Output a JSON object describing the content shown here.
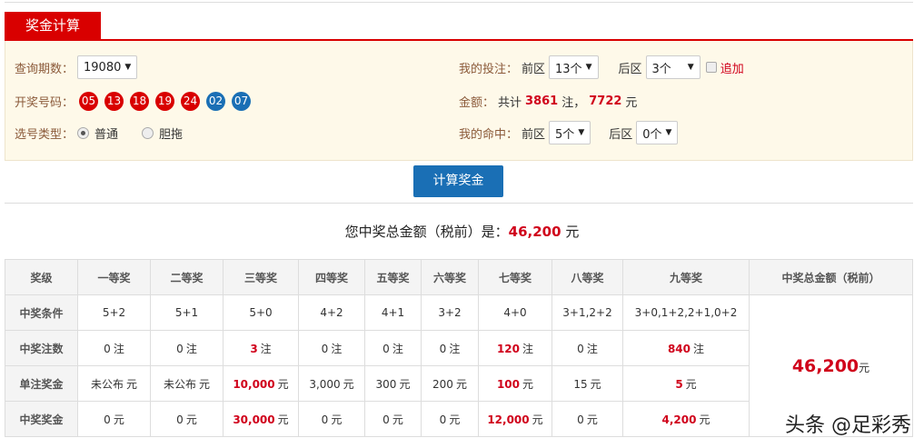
{
  "tab_title": "奖金计算",
  "query": {
    "label": "查询期数：",
    "value": "19080"
  },
  "draw": {
    "label": "开奖号码：",
    "front": [
      "05",
      "13",
      "18",
      "19",
      "24"
    ],
    "back": [
      "02",
      "07"
    ],
    "front_color": "#d90000",
    "back_color": "#1a6fb5"
  },
  "pick_type": {
    "label": "选号类型：",
    "options": [
      "普通",
      "胆拖"
    ],
    "selected": "普通"
  },
  "bet": {
    "label": "我的投注：",
    "front_label": "前区",
    "front_value": "13个",
    "back_label": "后区",
    "back_value": "3个",
    "addon_label": "追加"
  },
  "amount": {
    "label": "金额：",
    "prefix": "共计",
    "count": "3861",
    "unit1": "注，",
    "money": "7722",
    "unit2": "元"
  },
  "hit": {
    "label": "我的命中：",
    "front_label": "前区",
    "front_value": "5个",
    "back_label": "后区",
    "back_value": "0个"
  },
  "calc_button": "计算奖金",
  "total": {
    "prefix": "您中奖总金额（税前）是：",
    "value": "46,200",
    "unit": "元"
  },
  "table": {
    "headers": [
      "奖级",
      "一等奖",
      "二等奖",
      "三等奖",
      "四等奖",
      "五等奖",
      "六等奖",
      "七等奖",
      "八等奖",
      "九等奖",
      "中奖总金额（税前）"
    ],
    "rows": [
      {
        "label": "中奖条件",
        "cells": [
          "5+2",
          "5+1",
          "5+0",
          "4+2",
          "4+1",
          "3+2",
          "4+0",
          "3+1,2+2",
          "3+0,1+2,2+1,0+2"
        ]
      },
      {
        "label": "中奖注数",
        "cells": [
          "0",
          "0",
          "3",
          "0",
          "0",
          "0",
          "120",
          "0",
          "840"
        ],
        "unit": "注"
      },
      {
        "label": "单注奖金",
        "cells": [
          "未公布",
          "未公布",
          "10,000",
          "3,000",
          "300",
          "200",
          "100",
          "15",
          "5"
        ],
        "unit": "元"
      },
      {
        "label": "中奖奖金",
        "cells": [
          "0",
          "0",
          "30,000",
          "0",
          "0",
          "0",
          "12,000",
          "0",
          "4,200"
        ],
        "unit": "元"
      }
    ],
    "highlight_cols": [
      2,
      6,
      8
    ],
    "grand_total": "46,200",
    "grand_unit": "元"
  },
  "watermark": "头条 @足彩秀"
}
